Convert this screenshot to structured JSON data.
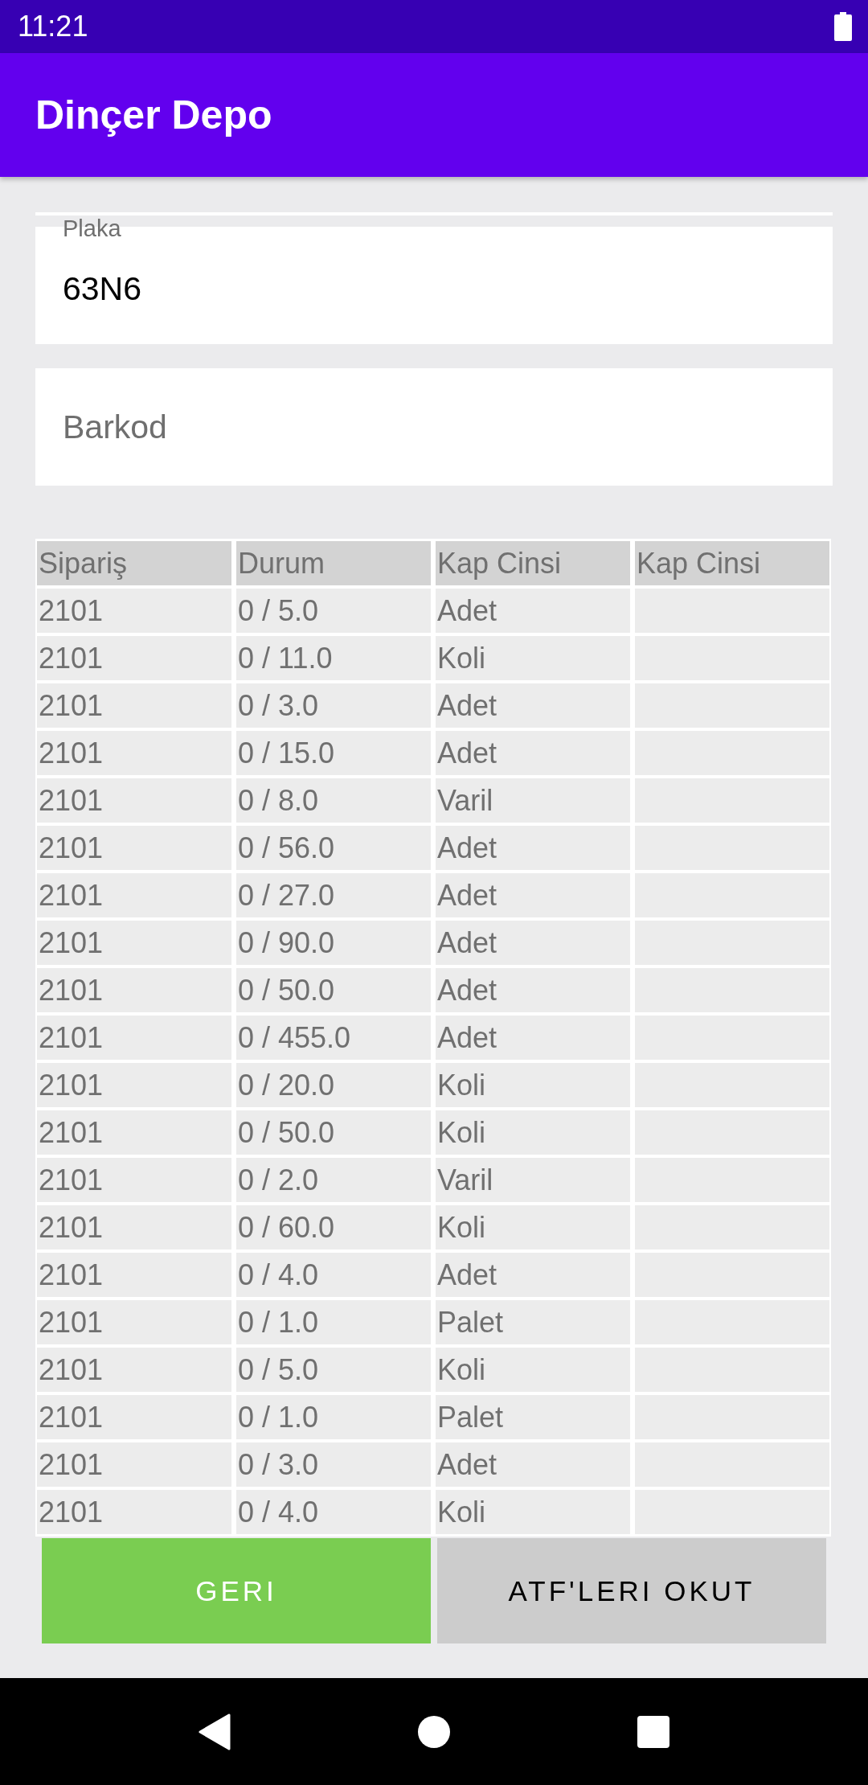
{
  "status_bar": {
    "time": "11:21"
  },
  "app_bar": {
    "title": "Dinçer Depo"
  },
  "fields": [
    {
      "label": "Plaka",
      "value": "63N6"
    },
    {
      "placeholder": "Barkod"
    }
  ],
  "table": {
    "columns": [
      "Sipariş",
      "Durum",
      "Kap Cinsi",
      "Kap Cinsi"
    ],
    "rows": [
      [
        "2101",
        "0 / 5.0",
        "Adet"
      ],
      [
        "2101",
        "0 / 11.0",
        "Koli"
      ],
      [
        "2101",
        "0 / 3.0",
        "Adet"
      ],
      [
        "2101",
        "0 / 15.0",
        "Adet"
      ],
      [
        "2101",
        "0 / 8.0",
        "Varil"
      ],
      [
        "2101",
        "0 / 56.0",
        "Adet"
      ],
      [
        "2101",
        "0 / 27.0",
        "Adet"
      ],
      [
        "2101",
        "0 / 90.0",
        "Adet"
      ],
      [
        "2101",
        "0 / 50.0",
        "Adet"
      ],
      [
        "2101",
        "0 / 455.0",
        "Adet"
      ],
      [
        "2101",
        "0 / 20.0",
        "Koli"
      ],
      [
        "2101",
        "0 / 50.0",
        "Koli"
      ],
      [
        "2101",
        "0 / 2.0",
        "Varil"
      ],
      [
        "2101",
        "0 / 60.0",
        "Koli"
      ],
      [
        "2101",
        "0 / 4.0",
        "Adet"
      ],
      [
        "2101",
        "0 / 1.0",
        "Palet"
      ],
      [
        "2101",
        "0 / 5.0",
        "Koli"
      ],
      [
        "2101",
        "0 / 1.0",
        "Palet"
      ],
      [
        "2101",
        "0 / 3.0",
        "Adet"
      ],
      [
        "2101",
        "0 / 4.0",
        "Koli"
      ]
    ]
  },
  "buttons": [
    {
      "label": "GERI",
      "kind": "primary"
    },
    {
      "label": "ATF'LERI OKUT",
      "kind": "secondary"
    }
  ]
}
